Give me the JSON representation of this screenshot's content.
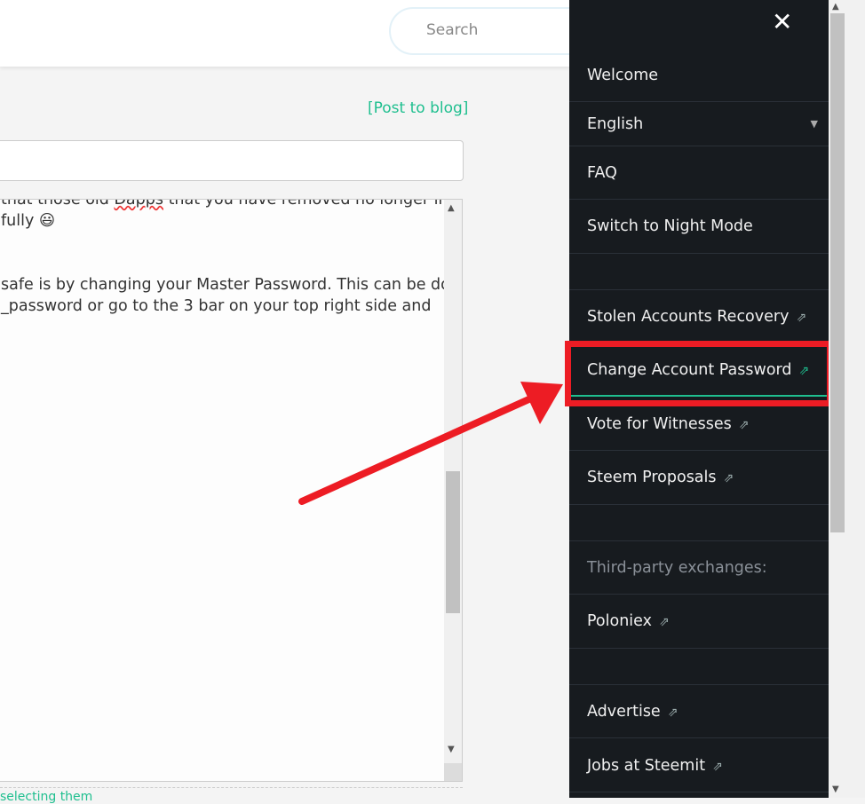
{
  "header": {
    "search_placeholder": "Search"
  },
  "editor": {
    "post_to_blog": "[Post to blog]",
    "lines": [
      "that those old ",
      "Dapps",
      " that you have removed no longer in",
      "fully 😃",
      "",
      "",
      "safe is by changing your Master Password. This can be done",
      "_password or go to the 3 bar on your top right side and"
    ],
    "hint": "selecting them"
  },
  "menu": {
    "close": "✕",
    "items": [
      {
        "label": "Welcome"
      },
      {
        "label": "English"
      },
      {
        "label": "FAQ"
      },
      {
        "label": "Switch to Night Mode"
      },
      {
        "label": "Stolen Accounts Recovery"
      },
      {
        "label": "Change Account Password"
      },
      {
        "label": "Vote for Witnesses"
      },
      {
        "label": "Steem Proposals"
      },
      {
        "label": "Third-party exchanges:"
      },
      {
        "label": "Poloniex"
      },
      {
        "label": "Advertise"
      },
      {
        "label": "Jobs at Steemit"
      }
    ]
  },
  "colors": {
    "accent": "#1fbf8f",
    "highlight": "#ed1c24",
    "sidebar": "#171b1f"
  }
}
